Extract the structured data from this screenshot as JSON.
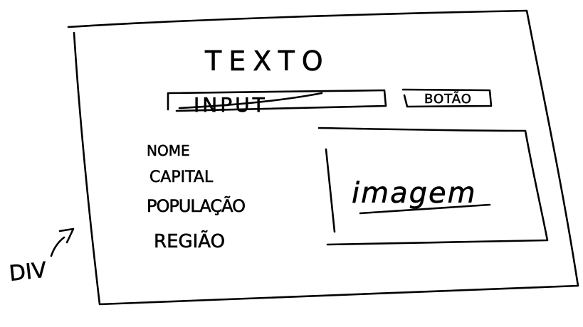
{
  "div_label": "DIV",
  "title": "TEXTO",
  "input_label": "INPUT",
  "button_label": "BOTÃO",
  "fields": [
    "NOME",
    "CAPITAL",
    "POPULAÇÃO",
    "REGIÃO"
  ],
  "image_label": "imagem"
}
